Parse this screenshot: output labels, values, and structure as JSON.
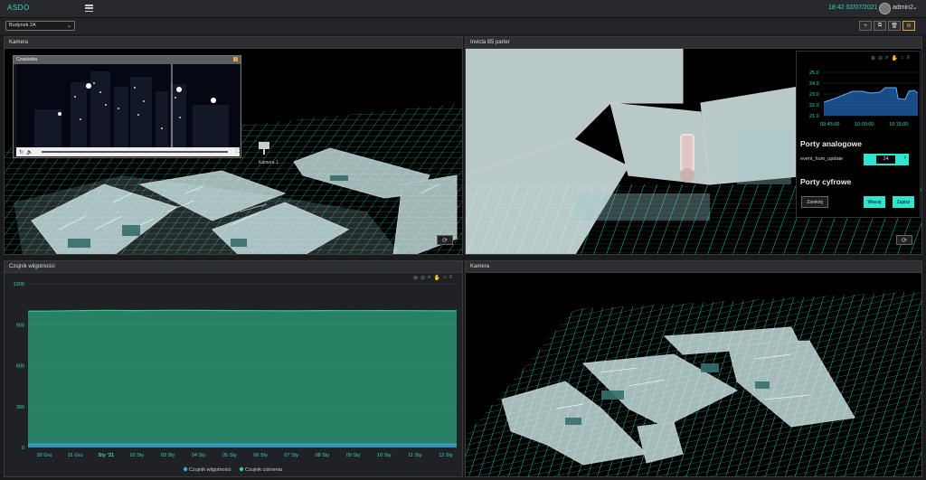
{
  "app": {
    "logo": "ASDO"
  },
  "header": {
    "datetime": "18:42  02/07/2021",
    "user": "admin2"
  },
  "toolbar": {
    "building_select": "Budynek 2A",
    "tools": [
      "+",
      "⧉",
      "🗑",
      "⚙"
    ]
  },
  "panels": {
    "camera1": {
      "title": "Kamera",
      "video_title": "Czasówka",
      "camera_label": "Kamera 1"
    },
    "model": {
      "title": "Invicta B5 parter",
      "mini_chart": {
        "y_labels": [
          "25.0",
          "24.0",
          "23.0",
          "22.0",
          "21.0"
        ],
        "x_labels": [
          "09:45:00",
          "10:00:00",
          "10:15:00"
        ]
      },
      "analog_heading": "Porty analogowe",
      "field_label": "event_hum_update",
      "field_value": "24",
      "digital_heading": "Porty cyfrowe",
      "btn_close": "Zamknij",
      "btn_more": "Więcej",
      "btn_apply": "Zapisz"
    },
    "humidity": {
      "title": "Czujnik wilgotności"
    },
    "camera2": {
      "title": "Kamera"
    }
  },
  "chart_data": {
    "type": "area",
    "x": [
      "30 Gru",
      "31 Gru",
      "Sty '21",
      "02 Sty",
      "03 Sty",
      "04 Sty",
      "05 Sty",
      "06 Sty",
      "07 Sty",
      "08 Sty",
      "09 Sty",
      "10 Sty",
      "11 Sty",
      "12 Sty"
    ],
    "ylim": [
      0,
      1200
    ],
    "yticks": [
      "1200",
      "900",
      "600",
      "300",
      "0"
    ],
    "series": [
      {
        "name": "Czujnik wilgotności",
        "color": "#3fa2e6",
        "values": [
          25,
          24,
          25,
          24,
          25,
          24,
          24,
          25,
          24,
          25,
          24,
          25,
          24,
          25
        ]
      },
      {
        "name": "Czujnik ciśnienia",
        "color": "#2fcf9a",
        "values": [
          1000,
          1003,
          1005,
          1004,
          1006,
          1005,
          1004,
          1003,
          1002,
          1004,
          1003,
          1004,
          1003,
          1002
        ]
      }
    ]
  }
}
